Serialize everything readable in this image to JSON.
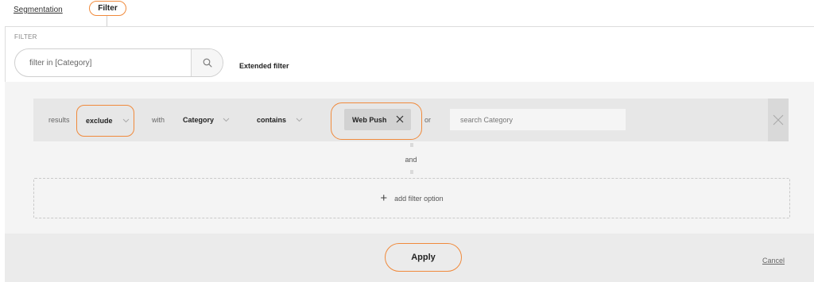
{
  "tabs": {
    "segmentation": "Segmentation",
    "filter": "Filter",
    "active": "Filter"
  },
  "filter_panel": {
    "caption": "FILTER",
    "search_placeholder": "filter in [Category]",
    "extended_label": "Extended filter"
  },
  "rule": {
    "results_label": "results",
    "mode_value": "exclude",
    "with_label": "with",
    "field_value": "Category",
    "operator_value": "contains",
    "chip_value": "Web Push",
    "or_label": "or",
    "search_placeholder": "search Category"
  },
  "connector_label": "and",
  "add_filter_label": "add filter option",
  "footer": {
    "apply_label": "Apply",
    "cancel_label": "Cancel"
  },
  "icons": {
    "search": "search-icon",
    "chevron": "chevron-down-icon",
    "close": "close-icon",
    "add": "plus-icon"
  },
  "colors": {
    "accent": "#f08a3c",
    "panel_bg": "#f4f4f4",
    "row_bg": "#e7e7e7",
    "chip_bg": "#d2d2d2"
  }
}
